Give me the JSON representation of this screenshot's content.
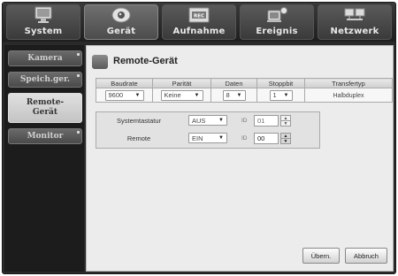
{
  "top_tabs": [
    {
      "label": "System",
      "icon": "monitor-icon"
    },
    {
      "label": "Gerät",
      "icon": "camera-icon"
    },
    {
      "label": "Aufnahme",
      "icon": "rec-icon"
    },
    {
      "label": "Ereignis",
      "icon": "event-icon"
    },
    {
      "label": "Netzwerk",
      "icon": "network-icon"
    }
  ],
  "active_top_tab": "Gerät",
  "sidebar": {
    "items": [
      {
        "label": "Kamera"
      },
      {
        "label": "Speich.ger."
      },
      {
        "label": "Remote-\nGerät"
      },
      {
        "label": "Monitor"
      }
    ],
    "active": "Remote-Gerät"
  },
  "panel": {
    "title": "Remote-Gerät",
    "serial_table": {
      "headers": [
        "Baudrate",
        "Parität",
        "Daten",
        "Stoppbit",
        "Transfertyp"
      ],
      "values": {
        "baudrate": "9600",
        "paritaet": "Keine",
        "daten": "8",
        "stoppbit": "1",
        "transfertyp": "Halbduplex"
      }
    },
    "rows": [
      {
        "label": "Systemtastatur",
        "value": "AUS",
        "id_label": "ID",
        "id_value": "01"
      },
      {
        "label": "Remote",
        "value": "EIN",
        "id_label": "ID",
        "id_value": "00"
      }
    ],
    "buttons": {
      "apply": "Übern.",
      "cancel": "Abbruch"
    }
  },
  "colors": {
    "background": "#2a2a2a",
    "panel": "#ececec",
    "active_sidebar": "#d0d0d0"
  }
}
